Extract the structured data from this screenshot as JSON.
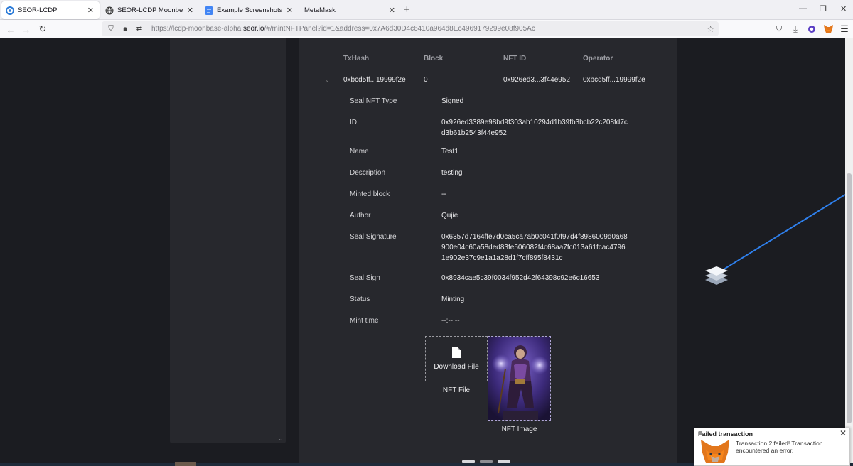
{
  "browser": {
    "tabs": [
      {
        "title": "SEOR-LCDP",
        "icon": "seor-logo-icon"
      },
      {
        "title": "SEOR-LCDP Moonbeam Testnet",
        "icon": "globe-icon"
      },
      {
        "title": "Example Screenshots of Moonb",
        "icon": "docs-icon"
      },
      {
        "title": "MetaMask",
        "icon": "none"
      }
    ],
    "url_prefix": "https://lcdp-moonbase-alpha.",
    "url_domain": "seor.io",
    "url_suffix": "/#/mintNFTPanel?id=1&address=0x7A6d30D4c6410a964d8Ec4969179299e08f905Ac"
  },
  "table": {
    "headers": [
      "TxHash",
      "Block",
      "NFT ID",
      "Operator"
    ],
    "row": {
      "txhash": "0xbcd5ff...19999f2e",
      "block": "0",
      "nft_id": "0x926ed3...3f44e952",
      "operator": "0xbcd5ff...19999f2e"
    }
  },
  "details": [
    {
      "label": "Seal NFT Type",
      "value": "Signed"
    },
    {
      "label": "ID",
      "value": "0x926ed3389e98bd9f303ab10294d1b39fb3bcb22c208fd7cd3b61b2543f44e952"
    },
    {
      "label": "Name",
      "value": "Test1"
    },
    {
      "label": "Description",
      "value": "testing"
    },
    {
      "label": "Minted block",
      "value": "--"
    },
    {
      "label": "Author",
      "value": "Qujie"
    },
    {
      "label": "Seal Signature",
      "value": "0x6357d7164ffe7d0ca5ca7ab0c041f0f97d4f8986009d0a68900e04c60a58ded83fe506082f4c68aa7fc013a61fcac47961e902e37c9e1a1a28d1f7cff895f8431c"
    },
    {
      "label": "Seal Sign",
      "value": "0x8934cae5c39f0034f952d42f64398c92e6c16653"
    },
    {
      "label": "Status",
      "value": "Minting"
    },
    {
      "label": "Mint time",
      "value": "--:--:--"
    }
  ],
  "files": {
    "download_label": "Download File",
    "nft_file_caption": "NFT File",
    "nft_image_caption": "NFT Image"
  },
  "notification": {
    "title": "Failed transaction",
    "message": "Transaction 2 failed! Transaction encountered an error."
  },
  "colors": {
    "page_bg": "#1b1c21",
    "panel_bg": "#27282d",
    "connector_line": "#2f80ed"
  }
}
